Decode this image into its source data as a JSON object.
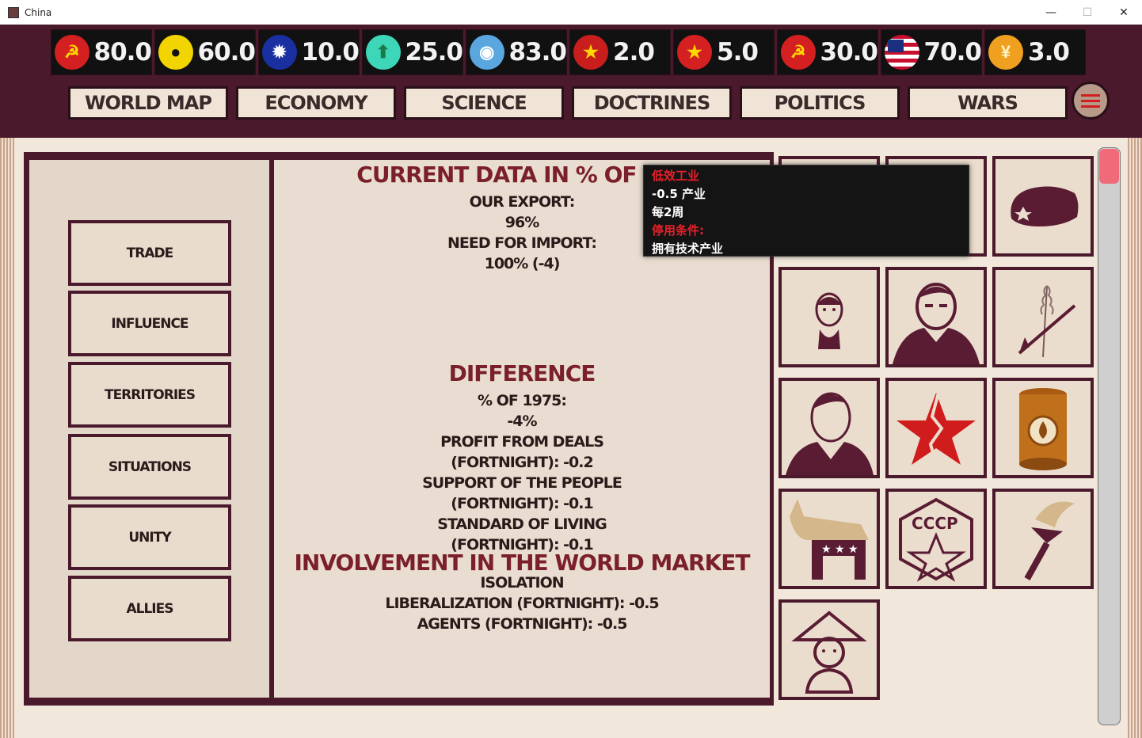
{
  "window": {
    "title": "China",
    "min_label": "—",
    "max_label": "☐",
    "close_label": "✕"
  },
  "resources": [
    {
      "icon": "hammer-sickle-hand-icon",
      "value": "80.0",
      "color": "#d42020"
    },
    {
      "icon": "person-hand-icon",
      "value": "60.0",
      "color": "#f2d400"
    },
    {
      "icon": "sun-emblem-icon",
      "value": "10.0",
      "color": "#1a2fa0"
    },
    {
      "icon": "green-arrow-icon",
      "value": "25.0",
      "color": "#3dd6b8"
    },
    {
      "icon": "un-globe-hand-icon",
      "value": "83.0",
      "color": "#5aa7e0"
    },
    {
      "icon": "vietnam-emblem-icon",
      "value": "2.0",
      "color": "#c81e1e"
    },
    {
      "icon": "china-emblem-icon",
      "value": "5.0",
      "color": "#d42020"
    },
    {
      "icon": "ussr-emblem-icon",
      "value": "30.0",
      "color": "#d42020"
    },
    {
      "icon": "usa-flag-icon",
      "value": "70.0",
      "color": "#e0e0e0"
    },
    {
      "icon": "yen-coin-icon",
      "value": "3.0",
      "color": "#f0a020"
    }
  ],
  "nav": [
    "WORLD MAP",
    "ECONOMY",
    "SCIENCE",
    "DOCTRINES",
    "POLITICS",
    "WARS"
  ],
  "side_buttons": [
    "TRADE",
    "INFLUENCE",
    "TERRITORIES",
    "SITUATIONS",
    "UNITY",
    "ALLIES"
  ],
  "center": {
    "title1": "CURRENT DATA IN % OF 197",
    "export_label": "OUR EXPORT:",
    "export_value": "96%",
    "import_label": "NEED FOR IMPORT:",
    "import_value": "100% (-4)",
    "title2": "DIFFERENCE",
    "pct_label": "% OF 1975:",
    "pct_value": "-4%",
    "profit_label": "PROFIT FROM DEALS",
    "profit_value": "(FORTNIGHT): -0.2",
    "support_label": "SUPPORT OF THE PEOPLE",
    "support_value": "(FORTNIGHT): -0.1",
    "living_label": "STANDARD OF LIVING",
    "living_value": "(FORTNIGHT): -0.1",
    "title3": "INVOLVEMENT IN THE WORLD MARKET",
    "isolation": "ISOLATION",
    "liberalization": "LIBERALIZATION (FORTNIGHT): -0.5",
    "agents": "AGENTS (FORTNIGHT): -0.5"
  },
  "tooltip": {
    "name": "低效工业",
    "effect": "-0.5 产业",
    "period": "每2周",
    "disable_label": "停用条件:",
    "condition": "拥有技术产业"
  },
  "tiles": [
    "blank-tile-1",
    "blank-tile-2",
    "military-cap-icon",
    "mao-portrait-icon",
    "leader-portrait-icon",
    "wheat-hoe-icon",
    "politician-portrait-icon",
    "broken-red-star-icon",
    "oil-barrel-icon",
    "donkey-icon",
    "cccp-badge-icon",
    "torch-icon",
    "farmer-icon"
  ],
  "colors": {
    "frame": "#4a1a2c",
    "paper": "#f1e7da",
    "title_red": "#7a1f2b",
    "tooltip_red": "#e8202a"
  }
}
